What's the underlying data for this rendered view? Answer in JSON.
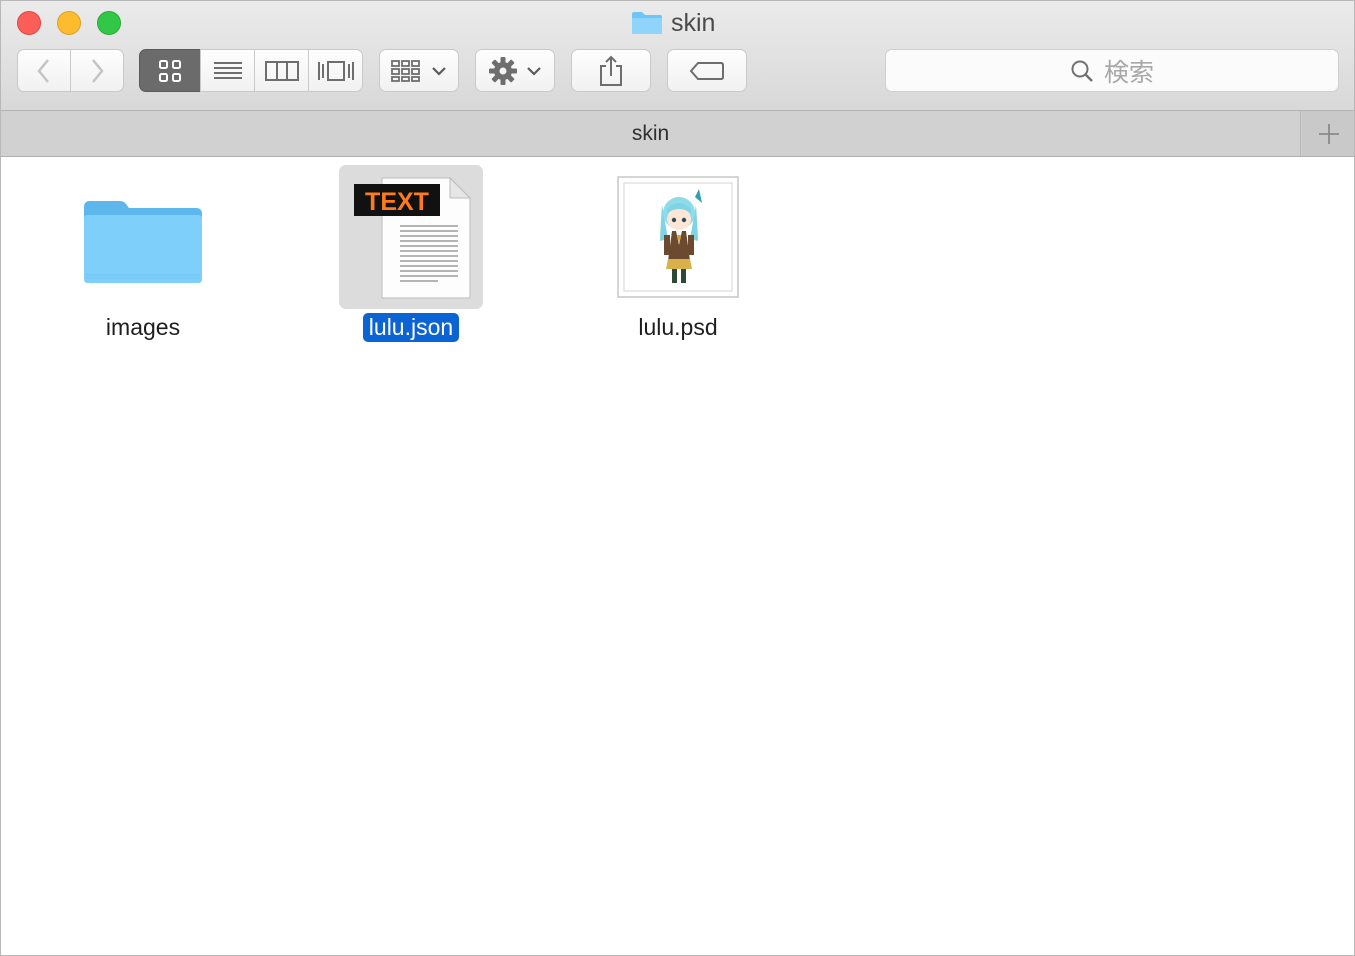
{
  "window": {
    "title": "skin",
    "title_icon": "folder-icon"
  },
  "toolbar": {
    "back_icon": "chevron-left-icon",
    "forward_icon": "chevron-right-icon",
    "view_modes": [
      "icon-view",
      "list-view",
      "column-view",
      "cover-flow-view"
    ],
    "active_view": "icon-view",
    "arrange_icon": "arrange-grid-icon",
    "action_icon": "gear-icon",
    "share_icon": "share-icon",
    "tag_icon": "tag-icon",
    "search_placeholder": "検索"
  },
  "tabbar": {
    "tab_label": "skin",
    "add_icon": "plus-icon"
  },
  "files": [
    {
      "name": "images",
      "kind": "folder",
      "selected": false
    },
    {
      "name": "lulu.json",
      "kind": "text-document",
      "badge": "TEXT",
      "selected": true
    },
    {
      "name": "lulu.psd",
      "kind": "image-thumbnail",
      "selected": false
    }
  ],
  "colors": {
    "selection": "#0c63d4",
    "folder": "#6cc5f7",
    "text_badge": "#ff7a1a"
  }
}
